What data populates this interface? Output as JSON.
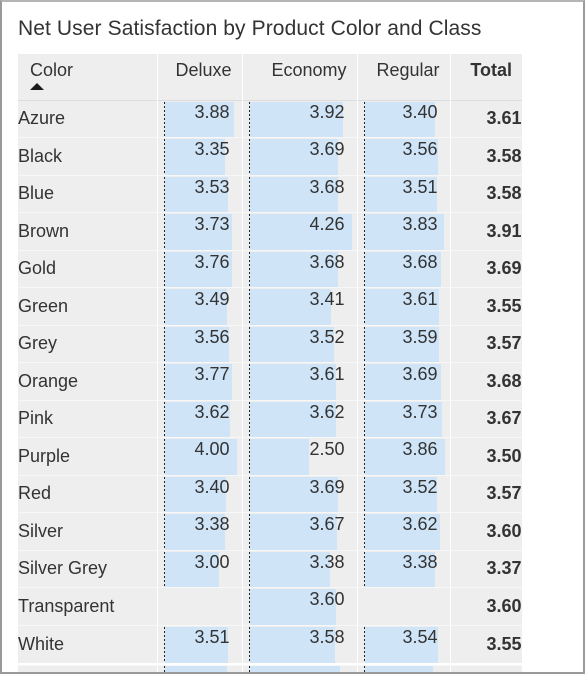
{
  "visual": {
    "title": "Net User Satisfaction by Product Color and Class",
    "title_color": "#333333",
    "sort_indicator": "sort-ascending-icon",
    "bar_color": "#cfe4f7",
    "axis_color": "#222222",
    "row_background": "#eeeeee"
  },
  "chart_data": {
    "type": "table",
    "title": "Net User Satisfaction by Product Color and Class",
    "xlabel": "",
    "ylabel": "",
    "columns": [
      "Color",
      "Deluxe",
      "Economy",
      "Regular",
      "Total"
    ],
    "row_key": "Color",
    "value_columns": [
      "Deluxe",
      "Economy",
      "Regular",
      "Total"
    ],
    "bar_columns": [
      "Deluxe",
      "Economy",
      "Regular"
    ],
    "sorted_by": "Color",
    "sort_direction": "ascending",
    "categories": [
      "Azure",
      "Black",
      "Blue",
      "Brown",
      "Gold",
      "Green",
      "Grey",
      "Orange",
      "Pink",
      "Purple",
      "Red",
      "Silver",
      "Silver Grey",
      "Transparent",
      "White"
    ],
    "series": [
      {
        "name": "Deluxe",
        "values": [
          3.88,
          3.35,
          3.53,
          3.73,
          3.76,
          3.49,
          3.56,
          3.77,
          3.62,
          4.0,
          3.4,
          3.38,
          3.0,
          null,
          3.51
        ]
      },
      {
        "name": "Economy",
        "values": [
          3.92,
          3.69,
          3.68,
          4.26,
          3.68,
          3.41,
          3.52,
          3.61,
          3.62,
          2.5,
          3.69,
          3.67,
          3.38,
          3.6,
          3.58
        ]
      },
      {
        "name": "Regular",
        "values": [
          3.4,
          3.56,
          3.51,
          3.83,
          3.68,
          3.61,
          3.59,
          3.69,
          3.73,
          3.86,
          3.52,
          3.62,
          3.38,
          null,
          3.54
        ]
      },
      {
        "name": "Total",
        "values": [
          3.61,
          3.58,
          3.58,
          3.91,
          3.69,
          3.55,
          3.57,
          3.68,
          3.67,
          3.5,
          3.57,
          3.6,
          3.37,
          3.6,
          3.55
        ]
      }
    ],
    "bar_scale": {
      "min": 0,
      "max_by_column": {
        "Deluxe": 4.0,
        "Economy": 4.26,
        "Regular": 3.86
      }
    }
  },
  "header": {
    "color": "Color",
    "deluxe": "Deluxe",
    "economy": "Economy",
    "regular": "Regular",
    "total": "Total"
  },
  "rows": [
    {
      "color": "Azure",
      "deluxe": "3.88",
      "economy": "3.92",
      "regular": "3.40",
      "total": "3.61"
    },
    {
      "color": "Black",
      "deluxe": "3.35",
      "economy": "3.69",
      "regular": "3.56",
      "total": "3.58"
    },
    {
      "color": "Blue",
      "deluxe": "3.53",
      "economy": "3.68",
      "regular": "3.51",
      "total": "3.58"
    },
    {
      "color": "Brown",
      "deluxe": "3.73",
      "economy": "4.26",
      "regular": "3.83",
      "total": "3.91"
    },
    {
      "color": "Gold",
      "deluxe": "3.76",
      "economy": "3.68",
      "regular": "3.68",
      "total": "3.69"
    },
    {
      "color": "Green",
      "deluxe": "3.49",
      "economy": "3.41",
      "regular": "3.61",
      "total": "3.55"
    },
    {
      "color": "Grey",
      "deluxe": "3.56",
      "economy": "3.52",
      "regular": "3.59",
      "total": "3.57"
    },
    {
      "color": "Orange",
      "deluxe": "3.77",
      "economy": "3.61",
      "regular": "3.69",
      "total": "3.68"
    },
    {
      "color": "Pink",
      "deluxe": "3.62",
      "economy": "3.62",
      "regular": "3.73",
      "total": "3.67"
    },
    {
      "color": "Purple",
      "deluxe": "4.00",
      "economy": "2.50",
      "regular": "3.86",
      "total": "3.50"
    },
    {
      "color": "Red",
      "deluxe": "3.40",
      "economy": "3.69",
      "regular": "3.52",
      "total": "3.57"
    },
    {
      "color": "Silver",
      "deluxe": "3.38",
      "economy": "3.67",
      "regular": "3.62",
      "total": "3.60"
    },
    {
      "color": "Silver Grey",
      "deluxe": "3.00",
      "economy": "3.38",
      "regular": "3.38",
      "total": "3.37"
    },
    {
      "color": "Transparent",
      "deluxe": "",
      "economy": "3.60",
      "regular": "",
      "total": "3.60"
    },
    {
      "color": "White",
      "deluxe": "3.51",
      "economy": "3.58",
      "regular": "3.54",
      "total": "3.55"
    }
  ]
}
